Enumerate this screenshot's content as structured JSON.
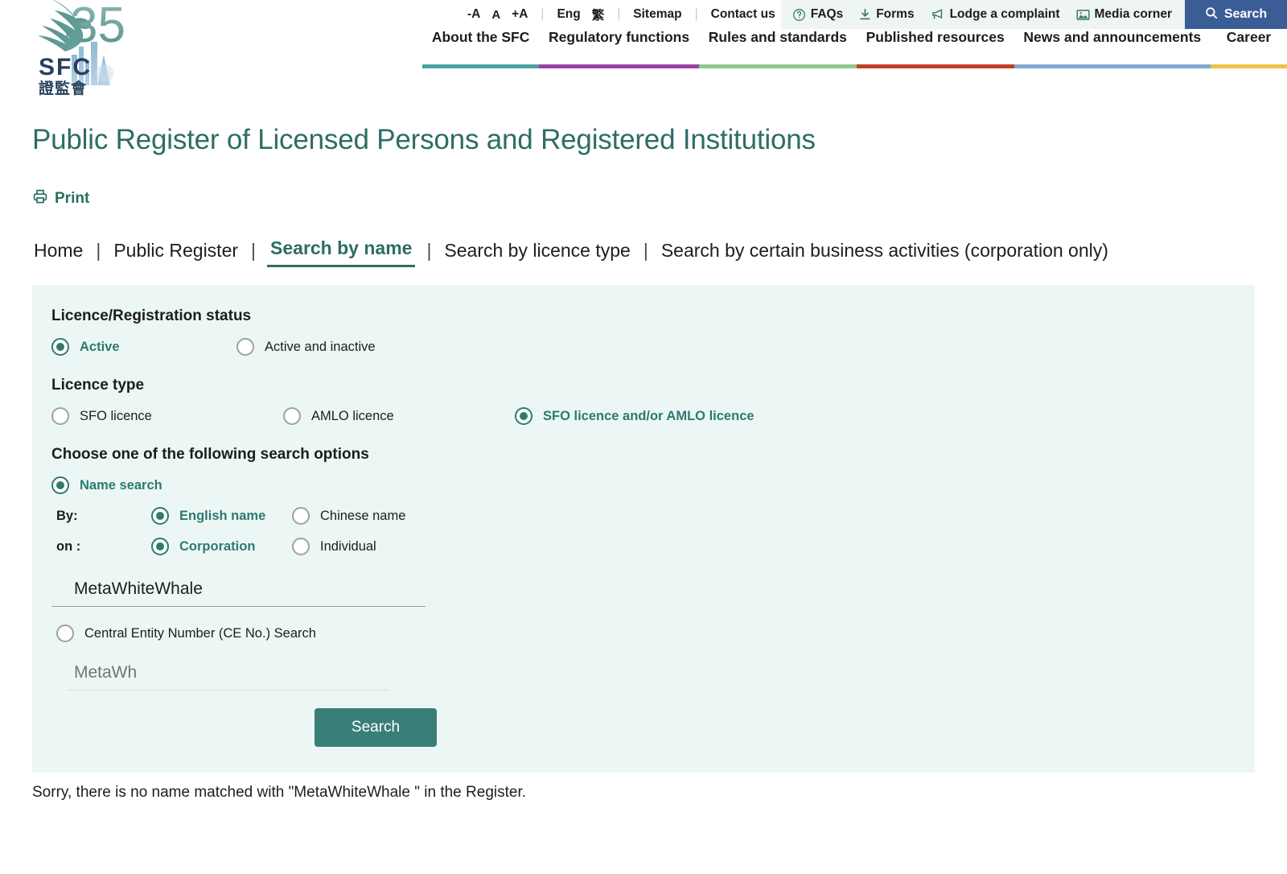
{
  "topbar": {
    "font_decrease": "-A",
    "font_normal": "A",
    "font_increase": "+A",
    "lang_en": "Eng",
    "lang_zh": "繁",
    "sitemap": "Sitemap",
    "contact": "Contact us",
    "quick_links": [
      {
        "label": "FAQs",
        "icon": "question-circle-icon"
      },
      {
        "label": "Forms",
        "icon": "download-icon"
      },
      {
        "label": "Lodge a complaint",
        "icon": "megaphone-icon"
      },
      {
        "label": "Media corner",
        "icon": "image-icon"
      }
    ],
    "search_button": "Search",
    "search_icon": "search-icon"
  },
  "logo": {
    "org_abbrev": "SFC",
    "org_chinese": "證監會",
    "anniversary": "35",
    "icon": "eagle-icon"
  },
  "mainnav": {
    "items": [
      {
        "label": "About the SFC",
        "color": "#4aa3a0"
      },
      {
        "label": "Regulatory functions",
        "color": "#9b3fa3"
      },
      {
        "label": "Rules and standards",
        "color": "#8dc98a"
      },
      {
        "label": "Published resources",
        "color": "#c0402a"
      },
      {
        "label": "News and announcements",
        "color": "#7fa8cf"
      },
      {
        "label": "Career",
        "color": "#f0c14b"
      }
    ]
  },
  "page": {
    "title": "Public Register of Licensed Persons and Registered Institutions",
    "print_label": "Print",
    "print_icon": "printer-icon",
    "title_color": "#2d6d63"
  },
  "tabs": {
    "separator": "|",
    "items": [
      {
        "label": "Home",
        "active": false
      },
      {
        "label": "Public Register",
        "active": false
      },
      {
        "label": "Search by name",
        "active": true
      },
      {
        "label": "Search by licence type",
        "active": false
      },
      {
        "label": "Search by certain business activities (corporation only)",
        "active": false
      }
    ]
  },
  "form": {
    "status_heading": "Licence/Registration status",
    "status_options": [
      {
        "label": "Active",
        "selected": true
      },
      {
        "label": "Active and inactive",
        "selected": false
      }
    ],
    "licence_type_heading": "Licence type",
    "licence_type_options": [
      {
        "label": "SFO licence",
        "selected": false
      },
      {
        "label": "AMLO licence",
        "selected": false
      },
      {
        "label": "SFO licence and/or AMLO licence",
        "selected": true
      }
    ],
    "search_options_heading": "Choose one of the following search options",
    "name_search": {
      "label": "Name search",
      "selected": true
    },
    "by_prefix": "By:",
    "by_options": [
      {
        "label": "English name",
        "selected": true
      },
      {
        "label": "Chinese name",
        "selected": false
      }
    ],
    "on_prefix": "on :",
    "on_options": [
      {
        "label": "Corporation",
        "selected": true
      },
      {
        "label": "Individual",
        "selected": false
      }
    ],
    "name_input_value": "MetaWhiteWhale",
    "name_input_placeholder": "",
    "ce_search": {
      "label": "Central Entity Number (CE No.) Search",
      "selected": false
    },
    "ce_input_value": "",
    "ce_input_placeholder": "MetaWh",
    "submit_label": "Search",
    "submit_color": "#3a7f77",
    "panel_color": "#ecf7f5"
  },
  "result": {
    "message": "Sorry, there is no name matched with \"MetaWhiteWhale \" in the Register."
  }
}
